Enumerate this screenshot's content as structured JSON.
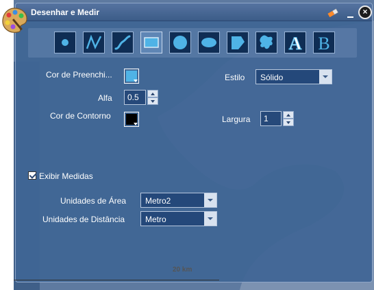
{
  "window": {
    "title": "Desenhar e Medir",
    "close_label": "×"
  },
  "toolbar": {
    "tools": [
      {
        "name": "point-tool",
        "icon": "point-icon",
        "active": false
      },
      {
        "name": "polyline-tool",
        "icon": "polyline-icon",
        "active": false
      },
      {
        "name": "freehand-line-tool",
        "icon": "freehand-line-icon",
        "active": false
      },
      {
        "name": "rectangle-tool",
        "icon": "rectangle-icon",
        "active": true
      },
      {
        "name": "circle-tool",
        "icon": "circle-icon",
        "active": false
      },
      {
        "name": "ellipse-tool",
        "icon": "ellipse-icon",
        "active": false
      },
      {
        "name": "polygon-tool",
        "icon": "polygon-icon",
        "active": false
      },
      {
        "name": "freehand-polygon-tool",
        "icon": "freehand-polygon-icon",
        "active": false
      },
      {
        "name": "text-tool",
        "icon": "text-icon",
        "active": false,
        "glyph": "A"
      },
      {
        "name": "bold-text-tool",
        "icon": "text-b-icon",
        "active": false,
        "glyph": "B"
      }
    ]
  },
  "form": {
    "fill_color_label": "Cor de Preenchi...",
    "fill_color": "#4fb3e6",
    "alpha_label": "Alfa",
    "alpha_value": "0.5",
    "outline_color_label": "Cor de Contorno",
    "outline_color": "#000000",
    "style_label": "Estilo",
    "style_value": "Sólido",
    "width_label": "Largura",
    "width_value": "1",
    "show_measures_label": "Exibir Medidas",
    "show_measures_checked": true,
    "area_units_label": "Unidades de Área",
    "area_units_value": "Metro2",
    "distance_units_label": "Unidades de Distância",
    "distance_units_value": "Metro"
  },
  "map": {
    "scale_label": "20 km"
  },
  "colors": {
    "panel": "#3f6594",
    "tool_bg": "#0f2d54",
    "tool_accent": "#4fb3e6"
  }
}
